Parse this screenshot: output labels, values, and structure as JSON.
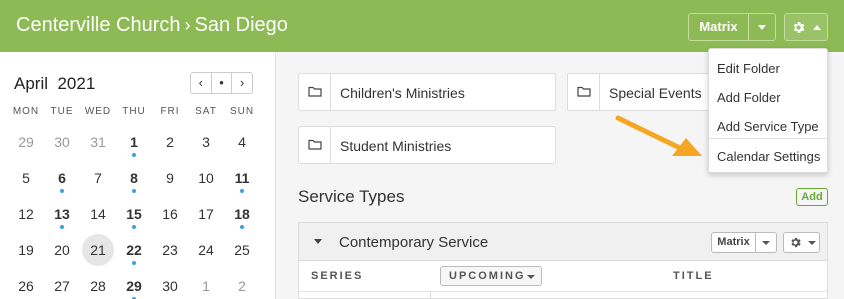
{
  "header": {
    "org": "Centerville Church",
    "separator": "›",
    "location": "San Diego",
    "matrix_label": "Matrix"
  },
  "calendar": {
    "month": "April",
    "year": "2021",
    "nav": {
      "prev": "‹",
      "today": "•",
      "next": "›"
    },
    "weekdays": [
      "MON",
      "TUE",
      "WED",
      "THU",
      "FRI",
      "SAT",
      "SUN"
    ],
    "weeks": [
      [
        {
          "d": "29",
          "m": true
        },
        {
          "d": "30",
          "m": true
        },
        {
          "d": "31",
          "m": true
        },
        {
          "d": "1",
          "b": true,
          "dot": true
        },
        {
          "d": "2"
        },
        {
          "d": "3"
        },
        {
          "d": "4"
        }
      ],
      [
        {
          "d": "5"
        },
        {
          "d": "6",
          "b": true,
          "dot": true
        },
        {
          "d": "7"
        },
        {
          "d": "8",
          "b": true,
          "dot": true
        },
        {
          "d": "9"
        },
        {
          "d": "10"
        },
        {
          "d": "11",
          "b": true,
          "dot": true
        }
      ],
      [
        {
          "d": "12"
        },
        {
          "d": "13",
          "b": true,
          "dot": true
        },
        {
          "d": "14"
        },
        {
          "d": "15",
          "b": true,
          "dot": true
        },
        {
          "d": "16"
        },
        {
          "d": "17"
        },
        {
          "d": "18",
          "b": true,
          "dot": true
        }
      ],
      [
        {
          "d": "19"
        },
        {
          "d": "20"
        },
        {
          "d": "21",
          "today": true
        },
        {
          "d": "22",
          "b": true,
          "dot": true
        },
        {
          "d": "23"
        },
        {
          "d": "24"
        },
        {
          "d": "25"
        }
      ],
      [
        {
          "d": "26"
        },
        {
          "d": "27"
        },
        {
          "d": "28"
        },
        {
          "d": "29",
          "b": true,
          "dot": true
        },
        {
          "d": "30"
        },
        {
          "d": "1",
          "m": true
        },
        {
          "d": "2",
          "m": true
        }
      ]
    ]
  },
  "folders": [
    {
      "label": "Children's Ministries"
    },
    {
      "label": "Special Events"
    },
    {
      "label": "Student Ministries"
    }
  ],
  "service_types": {
    "title": "Service Types",
    "add_label": "Add",
    "items": [
      {
        "name": "Contemporary Service",
        "matrix_label": "Matrix"
      }
    ],
    "columns": {
      "series": "SERIES",
      "upcoming": "UPCOMING",
      "title": "TITLE"
    }
  },
  "dropdown": {
    "items": [
      "Edit Folder",
      "Add Folder",
      "Add Service Type",
      "Calendar Settings"
    ]
  },
  "colors": {
    "header_green": "#8dba54",
    "accent_dot": "#3aa3dd",
    "arrow_orange": "#f5a623",
    "add_green": "#6aa833"
  }
}
